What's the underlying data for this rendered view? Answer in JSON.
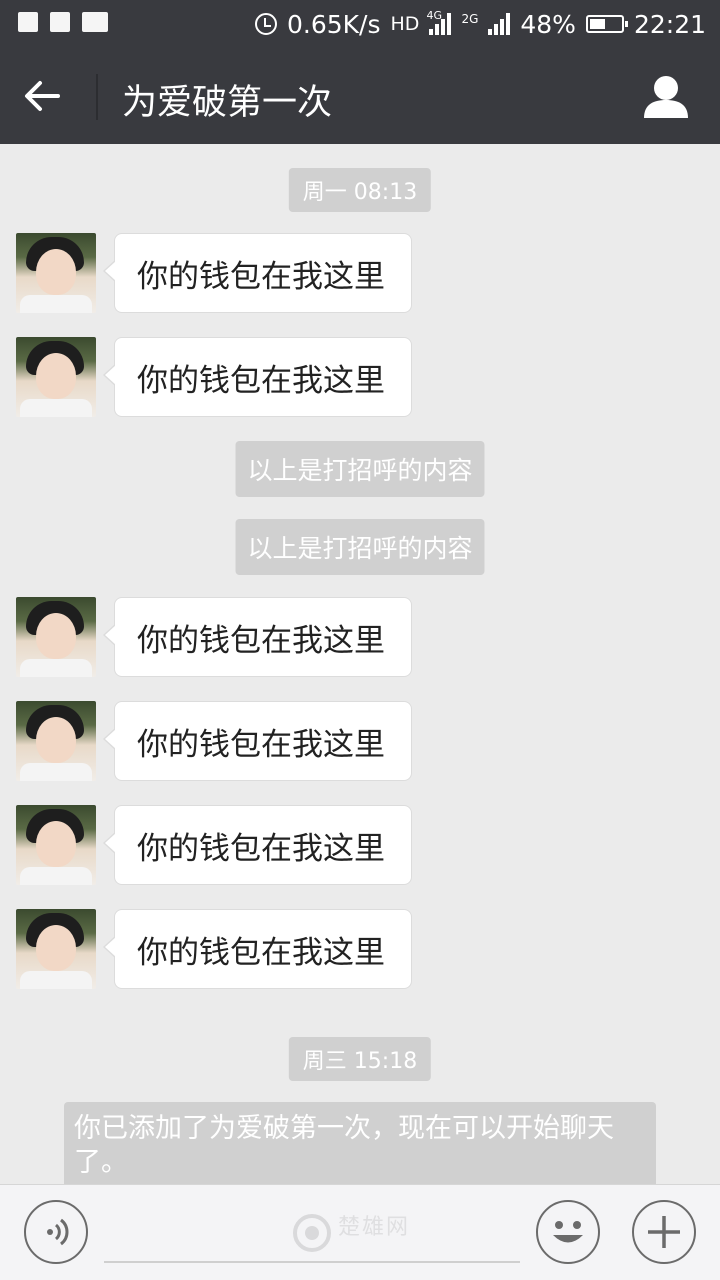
{
  "status_bar": {
    "speed": "0.65K/s",
    "network_hd": "HD",
    "network_4g": "4G",
    "network_2g": "2G",
    "battery_percent": "48%",
    "time": "22:21"
  },
  "header": {
    "title": "为爱破第一次"
  },
  "chat": {
    "time_1": "周一 08:13",
    "messages_group_1": [
      {
        "text": "你的钱包在我这里"
      },
      {
        "text": "你的钱包在我这里"
      }
    ],
    "system_1": "以上是打招呼的内容",
    "system_2": "以上是打招呼的内容",
    "messages_group_2": [
      {
        "text": "你的钱包在我这里"
      },
      {
        "text": "你的钱包在我这里"
      },
      {
        "text": "你的钱包在我这里"
      },
      {
        "text": "你的钱包在我这里"
      }
    ],
    "time_2": "周三 15:18",
    "notice": "你已添加了为爱破第一次，现在可以开始聊天了。"
  },
  "input_bar": {
    "watermark": "楚雄网"
  },
  "colors": {
    "header_bg": "#393a3f",
    "chat_bg": "#ebebeb",
    "chip_bg": "#d0d0d0"
  }
}
